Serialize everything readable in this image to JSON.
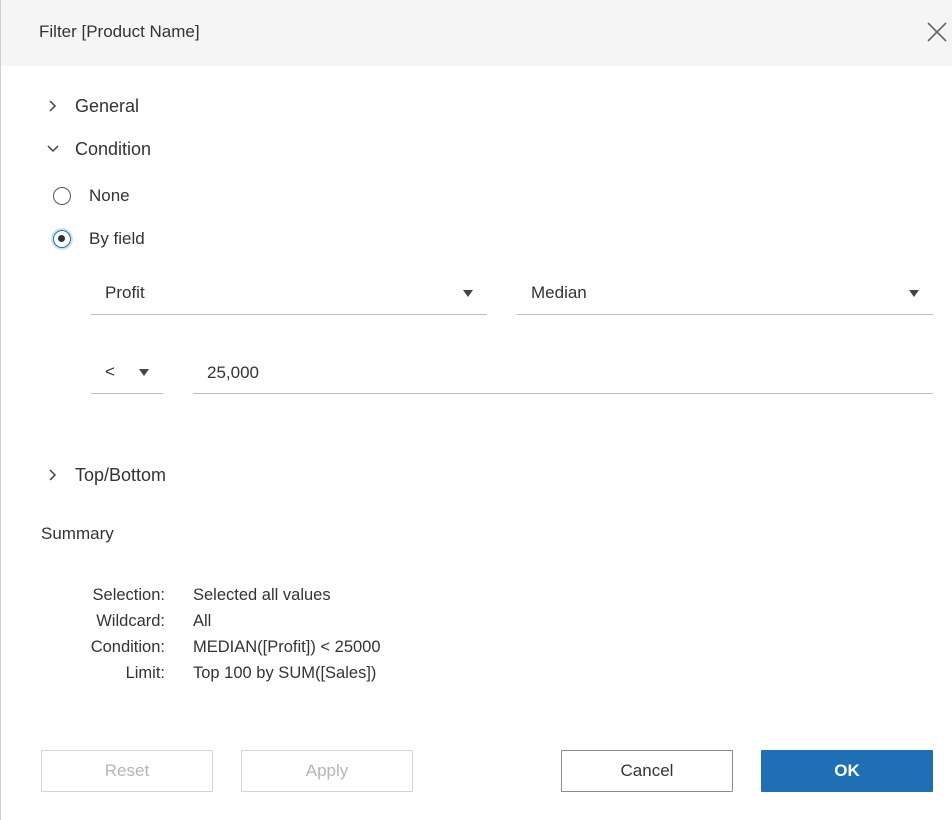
{
  "dialog": {
    "title": "Filter [Product Name]"
  },
  "sections": {
    "general": {
      "label": "General",
      "expanded": false
    },
    "condition": {
      "label": "Condition",
      "expanded": true
    },
    "top_bottom": {
      "label": "Top/Bottom",
      "expanded": false
    }
  },
  "condition": {
    "options": {
      "none": "None",
      "by_field": "By field"
    },
    "selected": "by_field",
    "field_select": "Profit",
    "aggregation_select": "Median",
    "operator_select": "<",
    "value_input": "25,000"
  },
  "summary": {
    "heading": "Summary",
    "rows": [
      {
        "key": "Selection:",
        "value": "Selected all values"
      },
      {
        "key": "Wildcard:",
        "value": "All"
      },
      {
        "key": "Condition:",
        "value": "MEDIAN([Profit]) < 25000"
      },
      {
        "key": "Limit:",
        "value": "Top 100 by SUM([Sales])"
      }
    ]
  },
  "buttons": {
    "reset": "Reset",
    "apply": "Apply",
    "cancel": "Cancel",
    "ok": "OK"
  },
  "colors": {
    "primary": "#1f6fb5",
    "titlebar_bg": "#f5f5f5"
  }
}
